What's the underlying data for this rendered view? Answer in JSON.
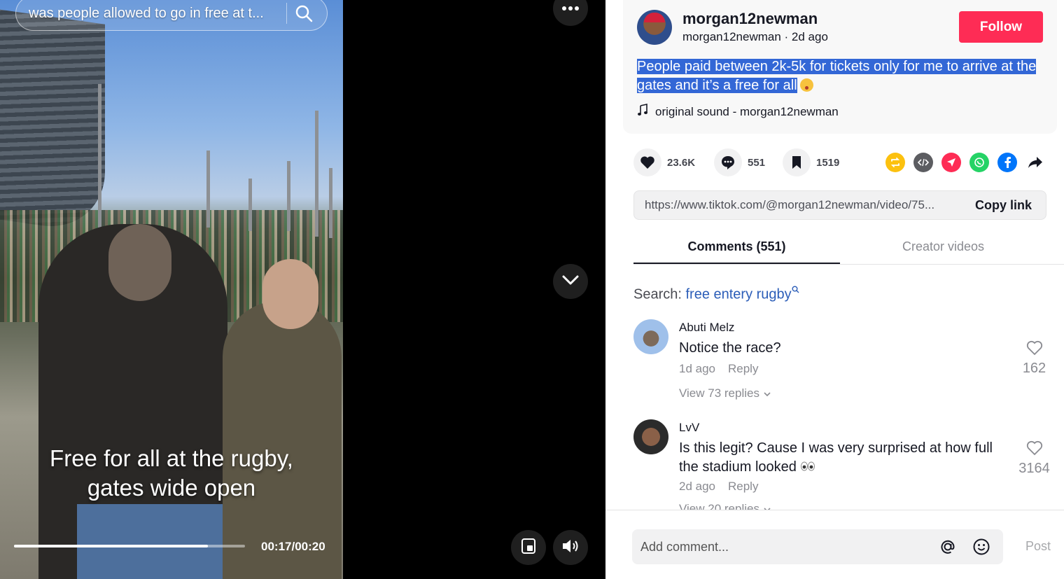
{
  "video": {
    "search_query": "was people allowed to go in free at t...",
    "caption_line1": "Free for all at the rugby,",
    "caption_line2": "gates wide open",
    "progress_fraction": 0.84,
    "time": "00:17/00:20"
  },
  "controls": {
    "more_icon": "more-dots-icon",
    "scroll_icon": "chevron-down-icon",
    "pip_icon": "mini-player-icon",
    "volume_icon": "volume-icon"
  },
  "post": {
    "username": "morgan12newman",
    "meta": "morgan12newman · 2d ago",
    "follow_label": "Follow",
    "description": "People paid between 2k-5k for tickets only for me to arrive at the gates and it’s a free for all",
    "sound": "original sound - morgan12newman"
  },
  "actions": {
    "likes": "23.6K",
    "comments": "551",
    "saves": "1519"
  },
  "share_icons": [
    "repost-icon",
    "embed-icon",
    "send-icon",
    "whatsapp-icon",
    "facebook-icon",
    "share-arrow-icon"
  ],
  "link": {
    "url": "https://www.tiktok.com/@morgan12newman/video/75...",
    "copy_label": "Copy link"
  },
  "tabs": {
    "comments": "Comments (551)",
    "creator": "Creator videos"
  },
  "search": {
    "label": "Search: ",
    "term": "free entery rugby"
  },
  "comments": [
    {
      "name": "Abuti Melz",
      "text": "Notice the race?",
      "time": "1d ago",
      "reply": "Reply",
      "replies": "View 73 replies",
      "likes": "162"
    },
    {
      "name": "LvV",
      "text": "Is this legit? Cause I was very surprised at how full the stadium looked",
      "time": "2d ago",
      "reply": "Reply",
      "replies": "View 20 replies",
      "likes": "3164"
    }
  ],
  "composer": {
    "placeholder": "Add comment...",
    "post_label": "Post"
  },
  "colors": {
    "accent": "#fe2c55",
    "highlight": "#3367d6",
    "link": "#2b5db8"
  }
}
